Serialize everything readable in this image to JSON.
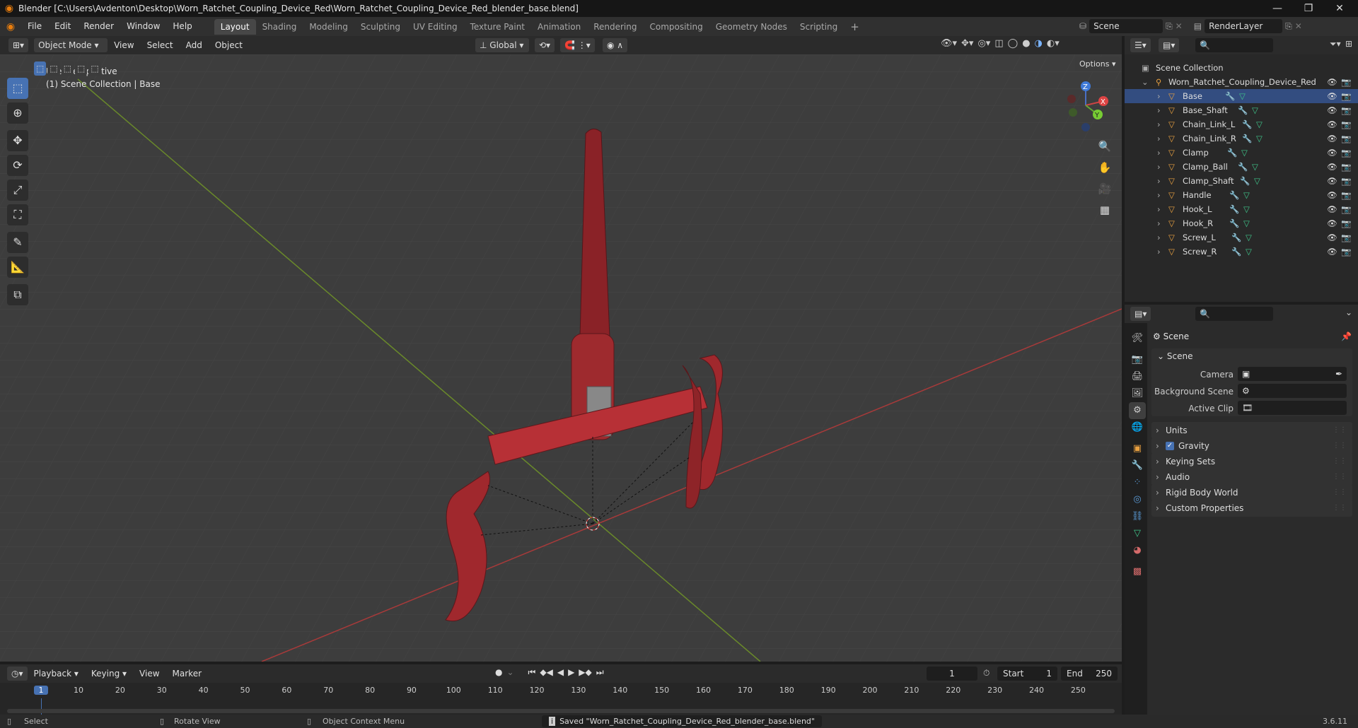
{
  "titlebar": {
    "title": "Blender [C:\\Users\\Avdenton\\Desktop\\Worn_Ratchet_Coupling_Device_Red\\Worn_Ratchet_Coupling_Device_Red_blender_base.blend]"
  },
  "menus": [
    "File",
    "Edit",
    "Render",
    "Window",
    "Help"
  ],
  "workspaces": [
    "Layout",
    "Shading",
    "Modeling",
    "Sculpting",
    "UV Editing",
    "Texture Paint",
    "Animation",
    "Rendering",
    "Compositing",
    "Geometry Nodes",
    "Scripting"
  ],
  "scene_field": "Scene",
  "renderlayer_field": "RenderLayer",
  "viewport_header": {
    "mode": "Object Mode",
    "menus": [
      "View",
      "Select",
      "Add",
      "Object"
    ],
    "orientation": "Global",
    "options": "Options"
  },
  "viewport_overlay": {
    "line1": "User Perspective",
    "line2": "(1) Scene Collection | Base"
  },
  "gizmo": {
    "z": "Z",
    "y": "Y",
    "x": "X"
  },
  "outliner": {
    "root": "Scene Collection",
    "collection": "Worn_Ratchet_Coupling_Device_Red",
    "objects": [
      "Base",
      "Base_Shaft",
      "Chain_Link_L",
      "Chain_Link_R",
      "Clamp",
      "Clamp_Ball",
      "Clamp_Shaft",
      "Handle",
      "Hook_L",
      "Hook_R",
      "Screw_L",
      "Screw_R"
    ]
  },
  "properties": {
    "header": "Scene",
    "panel": "Scene",
    "camera_label": "Camera",
    "bg_scene_label": "Background Scene",
    "active_clip_label": "Active Clip",
    "sections": [
      "Units",
      "Gravity",
      "Keying Sets",
      "Audio",
      "Rigid Body World",
      "Custom Properties"
    ],
    "gravity_checked": true
  },
  "timeline": {
    "menus": [
      "Playback",
      "Keying",
      "View",
      "Marker"
    ],
    "current_frame": "1",
    "start_label": "Start",
    "start": "1",
    "end_label": "End",
    "end": "250",
    "ticks": [
      "1",
      "10",
      "20",
      "30",
      "40",
      "50",
      "60",
      "70",
      "80",
      "90",
      "100",
      "110",
      "120",
      "130",
      "140",
      "150",
      "160",
      "170",
      "180",
      "190",
      "200",
      "210",
      "220",
      "230",
      "240",
      "250"
    ]
  },
  "statusbar": {
    "select": "Select",
    "rotate": "Rotate View",
    "context": "Object Context Menu",
    "message": "Saved \"Worn_Ratchet_Coupling_Device_Red_blender_base.blend\"",
    "version": "3.6.11"
  }
}
